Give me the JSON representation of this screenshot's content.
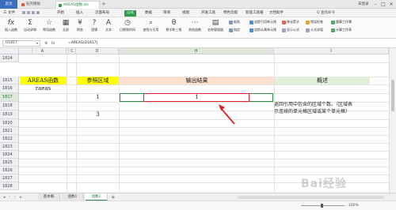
{
  "titlebar": {
    "home_tab": "首页",
    "tabs": [
      "稻壳模板",
      "AREAS函数.xls"
    ],
    "user": "未登录"
  },
  "menubar": {
    "file_menu": "三 文件",
    "items": [
      "开始",
      "插入",
      "页面布局",
      "公式",
      "数据",
      "审阅",
      "视图",
      "开发工具",
      "特色功能",
      "智能工具箱",
      "文档助手"
    ],
    "active": "公式",
    "search": "Q 查找命令"
  },
  "ribbon": {
    "insert_function": "插入函数",
    "buttons": [
      "自动求和",
      "常用函数",
      "全部",
      "财务",
      "逻辑",
      "文本",
      "日期和时间",
      "查找与引用",
      "数学和三角",
      "其他函数",
      "名称管理器"
    ],
    "small": [
      "粘贴",
      "指定",
      "追踪引用单元格",
      "追踪从属单元格",
      "移去箭头",
      "显示公式",
      "错误检查",
      "公式求值",
      "重算工作簿",
      "计算工作表"
    ]
  },
  "formulabar": {
    "name_box": "H1817",
    "formula": "=AREAS(D1817)"
  },
  "grid": {
    "columns": [
      "A",
      "B",
      "C",
      "D",
      "E",
      "F",
      "G",
      "H",
      "I"
    ],
    "rows": [
      "1814",
      "1815",
      "1816",
      "1817",
      "1818",
      "1819",
      "1820",
      "1821",
      "1822",
      "1823",
      "1824",
      "1825",
      "1826",
      "1827",
      "1828",
      "1829",
      "1830"
    ],
    "selected_column": "H",
    "selected_row": "1817",
    "b1815": "AREAS函数",
    "b1816": "raeas",
    "d1815": "参照区域",
    "d1817": "1",
    "d1819": "3",
    "h1815": "输出结果",
    "h1817": "1",
    "i1815": "概述",
    "description": "返回引用中包含的区域个数。（区域表示连续的单元格区域或某个单元格）"
  },
  "sheets": {
    "tabs": [
      "基本概",
      "函数1",
      "函数2"
    ],
    "active": "函数2",
    "add": "+"
  },
  "statusbar": {
    "zoom": "100%"
  },
  "colors": {
    "accent": "#2e8b46",
    "yellow": "#ffff00",
    "orange": "#fbe1cf",
    "green": "#e2efd9",
    "red": "#e0202a"
  }
}
